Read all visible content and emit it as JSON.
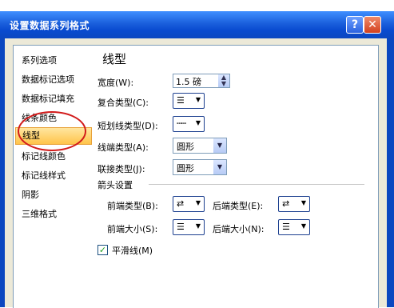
{
  "dialog": {
    "title": "设置数据系列格式",
    "help_icon": "?",
    "close_icon": "✕"
  },
  "nav": {
    "items": [
      "系列选项",
      "数据标记选项",
      "数据标记填充",
      "线条颜色",
      "线型",
      "标记线颜色",
      "标记线样式",
      "阴影",
      "三维格式"
    ],
    "selected": "线型"
  },
  "panel": {
    "title": "线型",
    "width": {
      "label": "宽度(W):",
      "value": "1.5 磅"
    },
    "compound_type": {
      "label": "复合类型(C):",
      "icon": "triple-line"
    },
    "dash_type": {
      "label": "短划线类型(D):",
      "icon": "dashed-line"
    },
    "cap_type": {
      "label": "线端类型(A):",
      "value": "圆形"
    },
    "join_type": {
      "label": "联接类型(J):",
      "value": "圆形"
    },
    "arrow_settings": {
      "title": "箭头设置",
      "begin_type_label": "前端类型(B):",
      "end_type_label": "后端类型(E):",
      "begin_size_label": "前端大小(S):",
      "end_size_label": "后端大小(N):"
    },
    "smooth_line": {
      "label": "平滑线(M)",
      "checked": true
    }
  },
  "colors": {
    "accent": "#0b47c0",
    "selected_bg": "#ffc44a",
    "annotation": "#d21a1a"
  }
}
